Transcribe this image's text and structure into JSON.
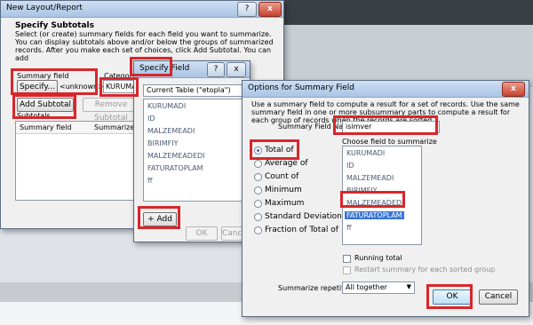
{
  "layout_dialog": {
    "title": "New Layout/Report",
    "help_btn": "?",
    "close_btn": "x",
    "section_title": "Specify Subtotals",
    "description": "Select (or create) summary fields for each field you want to summarize. You can display subtotals above and/or below the groups of summarized records. After you make each set of choices, click Add Subtotal. You can add",
    "summary_field_label": "Summary field",
    "specify_btn": "Specify...",
    "unknown_text": "<unknown>",
    "category_label": "Category to",
    "category_value": "KURUMADI",
    "add_subtotal_btn": "Add Subtotal",
    "remove_subtotal_btn": "Remove Subtotal",
    "subtotals_label": "Subtotals",
    "columns": [
      "Summary field",
      "Summarized by"
    ]
  },
  "specify_dialog": {
    "title": "Specify Field",
    "help_btn": "?",
    "close_btn": "x",
    "table_label": "Current Table (\"etopla\")",
    "fields": [
      "KURUMADI",
      "ID",
      "MALZEMEADI",
      "BIRIMFIY",
      "MALZEMEADEDI",
      "FATURATOPLAM",
      "ff"
    ],
    "add_btn": "+ Add",
    "ok_btn": "OK",
    "cancel_btn": "Cancel"
  },
  "options_dialog": {
    "title": "Options for Summary Field",
    "close_btn": "x",
    "description": "Use a summary field to compute a result for a set of records. Use the same summary field in one or more subsummary parts to compute a result for each group of records when the records are sorted.",
    "name_label": "Summary Field Name:",
    "name_value": "isimver",
    "choose_label": "Choose field to summarize",
    "types": [
      "Total of",
      "Average of",
      "Count of",
      "Minimum",
      "Maximum",
      "Standard Deviation of",
      "Fraction of Total of"
    ],
    "selected_type": "Total of",
    "fields": [
      "KURUMADI",
      "ID",
      "MALZEMEADI",
      "BIRIMFIY",
      "MALZEMEADEDI",
      "FATURATOPLAM",
      "ff"
    ],
    "selected_field": "FATURATOPLAM",
    "running_total": "Running total",
    "restart_summary": "Restart summary for each sorted group",
    "repetitions_label": "Summarize repetitions:",
    "repetitions_value": "All together",
    "ok_btn": "OK",
    "cancel_btn": "Cancel"
  },
  "colors": {
    "highlight": "#d8262b",
    "selection": "#3875d7"
  }
}
